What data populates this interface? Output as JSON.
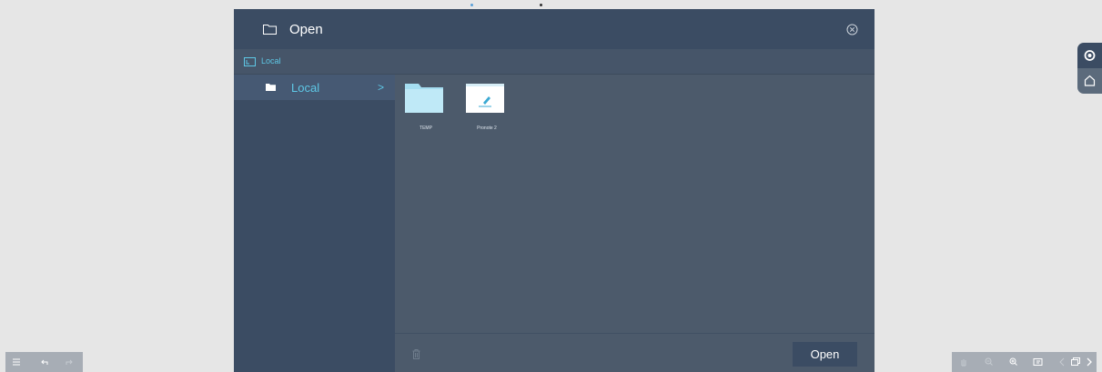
{
  "dialog": {
    "title": "Open",
    "breadcrumb": "Local",
    "sidebar": {
      "items": [
        {
          "label": "Local",
          "chevron": ">"
        }
      ]
    },
    "files": [
      {
        "name": "TEMP",
        "icon": "folder-icon"
      },
      {
        "name": "Pronote 2",
        "icon": "note-thumbnail"
      }
    ],
    "open_button": "Open"
  },
  "colors": {
    "accent": "#5ec8e6",
    "header": "#3b4c63",
    "panel": "#4c5a6b",
    "background": "#e6e6e6"
  },
  "right_tabs": [
    "eye-icon",
    "home-icon"
  ],
  "bottom_left_tools": [
    "menu-icon",
    "undo-icon",
    "redo-icon"
  ],
  "bottom_right_tools": [
    "hand-icon",
    "zoom-out-icon",
    "zoom-in-icon",
    "screen-icon",
    "prev-page-icon",
    "pages-icon",
    "next-page-icon"
  ]
}
